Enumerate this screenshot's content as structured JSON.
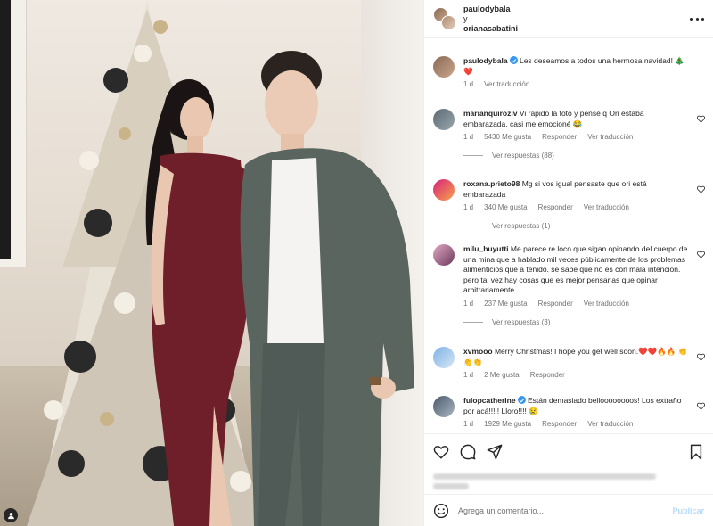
{
  "header": {
    "user1": "paulodybala",
    "conjunction": "y",
    "user2": "orianasabatini"
  },
  "caption": {
    "username": "paulodybala",
    "text": "Les deseamos a todos una hermosa navidad! 🎄",
    "text2": "❤️",
    "age": "1 d",
    "translate": "Ver traducción"
  },
  "comments": [
    {
      "username": "marianquiroziv",
      "text": "Vi rápido la foto y pensé q Ori estaba embarazada. casi me emocioné 😂",
      "age": "1 d",
      "likes": "5430 Me gusta",
      "reply": "Responder",
      "translate": "Ver traducción",
      "replies": "Ver respuestas (88)"
    },
    {
      "username": "roxana.prieto98",
      "text": "Mg si vos igual pensaste que ori está embarazada",
      "age": "1 d",
      "likes": "340 Me gusta",
      "reply": "Responder",
      "translate": "Ver traducción",
      "replies": "Ver respuestas (1)"
    },
    {
      "username": "milu_buyutti",
      "text": "Me parece re loco que sigan opinando del cuerpo de una mina que a hablado mil veces públicamente de los problemas alimenticios que a tenido. se sabe que no es con mala intención. pero tal vez hay cosas que es mejor pensarlas que opinar arbitrariamente",
      "age": "1 d",
      "likes": "237 Me gusta",
      "reply": "Responder",
      "translate": "Ver traducción",
      "replies": "Ver respuestas (3)"
    },
    {
      "username": "xvmooo",
      "text": "Merry Christmas! I hope you get well soon.❤️❤️🔥🔥 👏👏👏",
      "age": "1 d",
      "likes": "2 Me gusta",
      "reply": "Responder"
    },
    {
      "username": "fulopcatherine",
      "text": "Están demasiado belloooooooos! Los extraño por acá!!!!! Lloro!!!! 😢",
      "age": "1 d",
      "likes": "1929 Me gusta",
      "reply": "Responder",
      "translate": "Ver traducción"
    }
  ],
  "composer": {
    "placeholder": "Agrega un comentario...",
    "post": "Publicar"
  },
  "icons": {
    "more": "more-options-icon",
    "like": "heart-icon",
    "comment": "comment-icon",
    "share": "share-icon",
    "save": "bookmark-icon",
    "emoji": "emoji-icon",
    "tag": "user-tag-icon"
  },
  "colors": {
    "verified": "#3897f0",
    "post_disabled": "#b3dbff",
    "muted": "#737373"
  }
}
